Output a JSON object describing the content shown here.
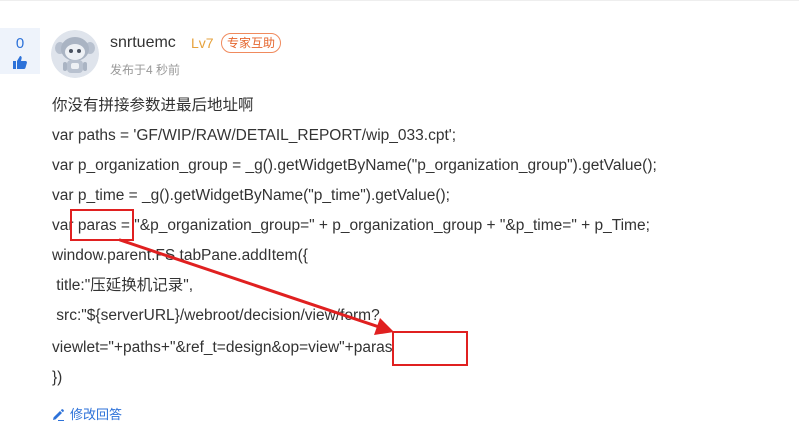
{
  "vote": {
    "count": "0",
    "icon": "thumbs-up-icon",
    "color": "#2d72d9"
  },
  "author": {
    "avatar_icon": "robot-avatar-icon",
    "name": "snrtuemc",
    "level": "Lv7",
    "badge": "专家互助",
    "posted": "发布于4 秒前"
  },
  "answer": {
    "lines": [
      "你没有拼接参数进最后地址啊",
      "var paths = 'GF/WIP/RAW/DETAIL_REPORT/wip_033.cpt';",
      "var p_organization_group = _g().getWidgetByName(\"p_organization_group\").getValue();",
      "var p_time = _g().getWidgetByName(\"p_time\").getValue();",
      "var paras = \"&p_organization_group=\" + p_organization_group + \"&p_time=\" + p_Time;",
      "window.parent.FS.tabPane.addItem({",
      " title:\"压延换机记录\",",
      " src:\"${serverURL}/webroot/decision/view/form?",
      "viewlet=\"+paths+\"&ref_t=design&op=view\"+paras",
      "})"
    ]
  },
  "annotation": {
    "color": "#e02020"
  },
  "actions": {
    "edit_icon": "pencil-icon",
    "edit_label": "修改回答"
  }
}
